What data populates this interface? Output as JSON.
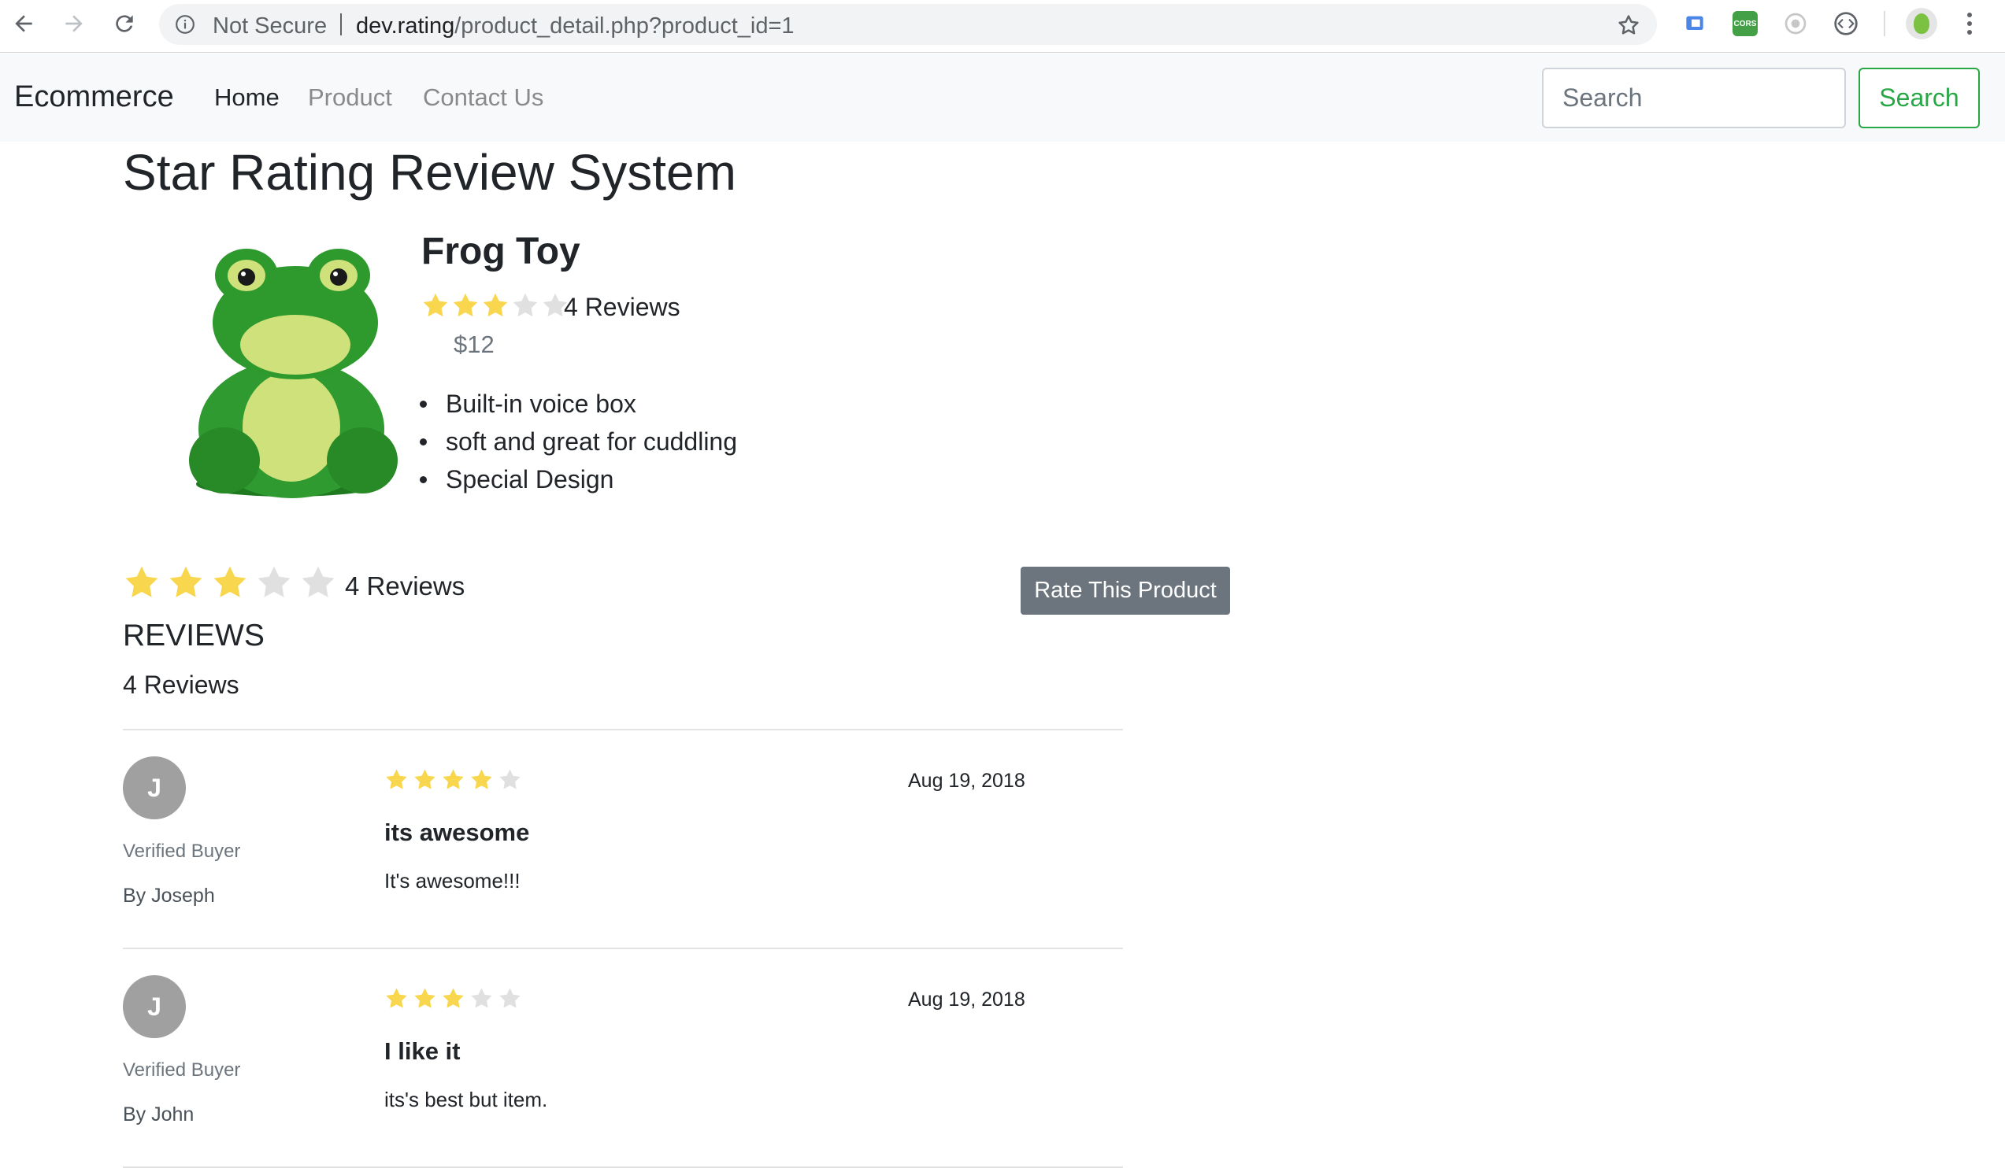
{
  "browser": {
    "security_label": "Not Secure",
    "url_host": "dev.rating",
    "url_path": "/product_detail.php?product_id=1",
    "extensions": [
      {
        "icon": "page-extension-icon",
        "color": "#4a86e8",
        "label": ""
      },
      {
        "icon": "cors-extension-icon",
        "color": "#43a047",
        "label": "CORS"
      },
      {
        "icon": "camera-extension-icon",
        "color": "#c7c7c7",
        "label": ""
      },
      {
        "icon": "code-extension-icon",
        "color": "#5f6368",
        "label": ""
      }
    ]
  },
  "navbar": {
    "brand": "Ecommerce",
    "links": [
      {
        "label": "Home",
        "active": true
      },
      {
        "label": "Product",
        "active": false
      },
      {
        "label": "Contact Us",
        "active": false
      }
    ],
    "search_placeholder": "Search",
    "search_button": "Search",
    "accent_color": "#28a745"
  },
  "page": {
    "title": "Star Rating Review System"
  },
  "product": {
    "name": "Frog Toy",
    "image_icon": "frog-toy-image",
    "rating": 3,
    "max_rating": 5,
    "reviews_label": "4 Reviews",
    "price": "$12",
    "features": [
      "Built-in voice box",
      "soft and great for cuddling",
      "Special Design"
    ]
  },
  "summary": {
    "rating": 3,
    "max_rating": 5,
    "reviews_label": "4 Reviews",
    "rate_button": "Rate This Product",
    "heading": "REVIEWS",
    "count_label": "4 Reviews"
  },
  "colors": {
    "star_filled": "#f8d64e",
    "star_empty": "#e0e0e0",
    "button_secondary": "#6c757d"
  },
  "reviews": [
    {
      "initial": "J",
      "badge": "Verified Buyer",
      "author": "By Joseph",
      "rating": 4,
      "date": "Aug 19, 2018",
      "title": "its awesome",
      "body": "It's awesome!!!"
    },
    {
      "initial": "J",
      "badge": "Verified Buyer",
      "author": "By John",
      "rating": 3,
      "date": "Aug 19, 2018",
      "title": "I like it",
      "body": "its's best but item."
    }
  ]
}
